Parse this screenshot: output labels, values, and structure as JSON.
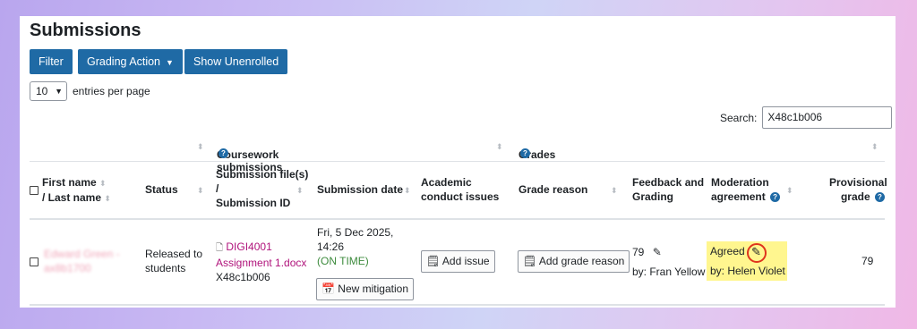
{
  "page": {
    "title": "Submissions"
  },
  "toolbar": {
    "filter": "Filter",
    "grading_action": "Grading Action",
    "show_unenrolled": "Show Unenrolled"
  },
  "entries": {
    "value": "10",
    "label": "entries per page"
  },
  "search": {
    "label": "Search:",
    "value": "X48c1b006"
  },
  "group_headers": {
    "coursework": "Coursework submissions",
    "grades": "Grades"
  },
  "columns": {
    "first_name": "First name",
    "last_name": "/ Last name",
    "status": "Status",
    "submission_file": "Submission file(s)",
    "slash": "/",
    "submission_id": "Submission ID",
    "submission_date": "Submission date",
    "academic_1": "Academic",
    "academic_2": "conduct issues",
    "grade_reason": "Grade reason",
    "feedback_1": "Feedback and",
    "feedback_2": "Grading",
    "moderation_1": "Moderation",
    "moderation_2": "agreement",
    "provisional_1": "Provisional",
    "provisional_2": "grade"
  },
  "row": {
    "name_1": "Edward Green -",
    "name_2": "ax8b1700",
    "dash": "-",
    "status_1": "Released to",
    "status_2": "students",
    "file_1": "DIGI4001",
    "file_2": "Assignment 1.docx",
    "submission_id": "X48c1b006",
    "date_1": "Fri, 5 Dec 2025,",
    "date_2": "14:26",
    "on_time": "(ON TIME)",
    "new_mitigation": "New mitigation",
    "add_issue": "Add issue",
    "add_grade_reason": "Add grade reason",
    "grade": "79",
    "feedback_by": "by: Fran Yellow",
    "moderation_status": "Agreed",
    "moderation_by": "by: Helen Violet",
    "provisional_grade": "79"
  },
  "icons": {
    "help": "question-circle-icon",
    "sort": "sort-arrows-icon",
    "file": "file-icon",
    "pencil": "pencil-icon",
    "calendar": "calendar-icon",
    "note": "note-edit-icon"
  },
  "colors": {
    "primary": "#1f6aa5",
    "link": "#b0137b",
    "on_time": "#3d8b3d",
    "highlight": "#fff68f",
    "annotation_ring": "#e0341d"
  }
}
